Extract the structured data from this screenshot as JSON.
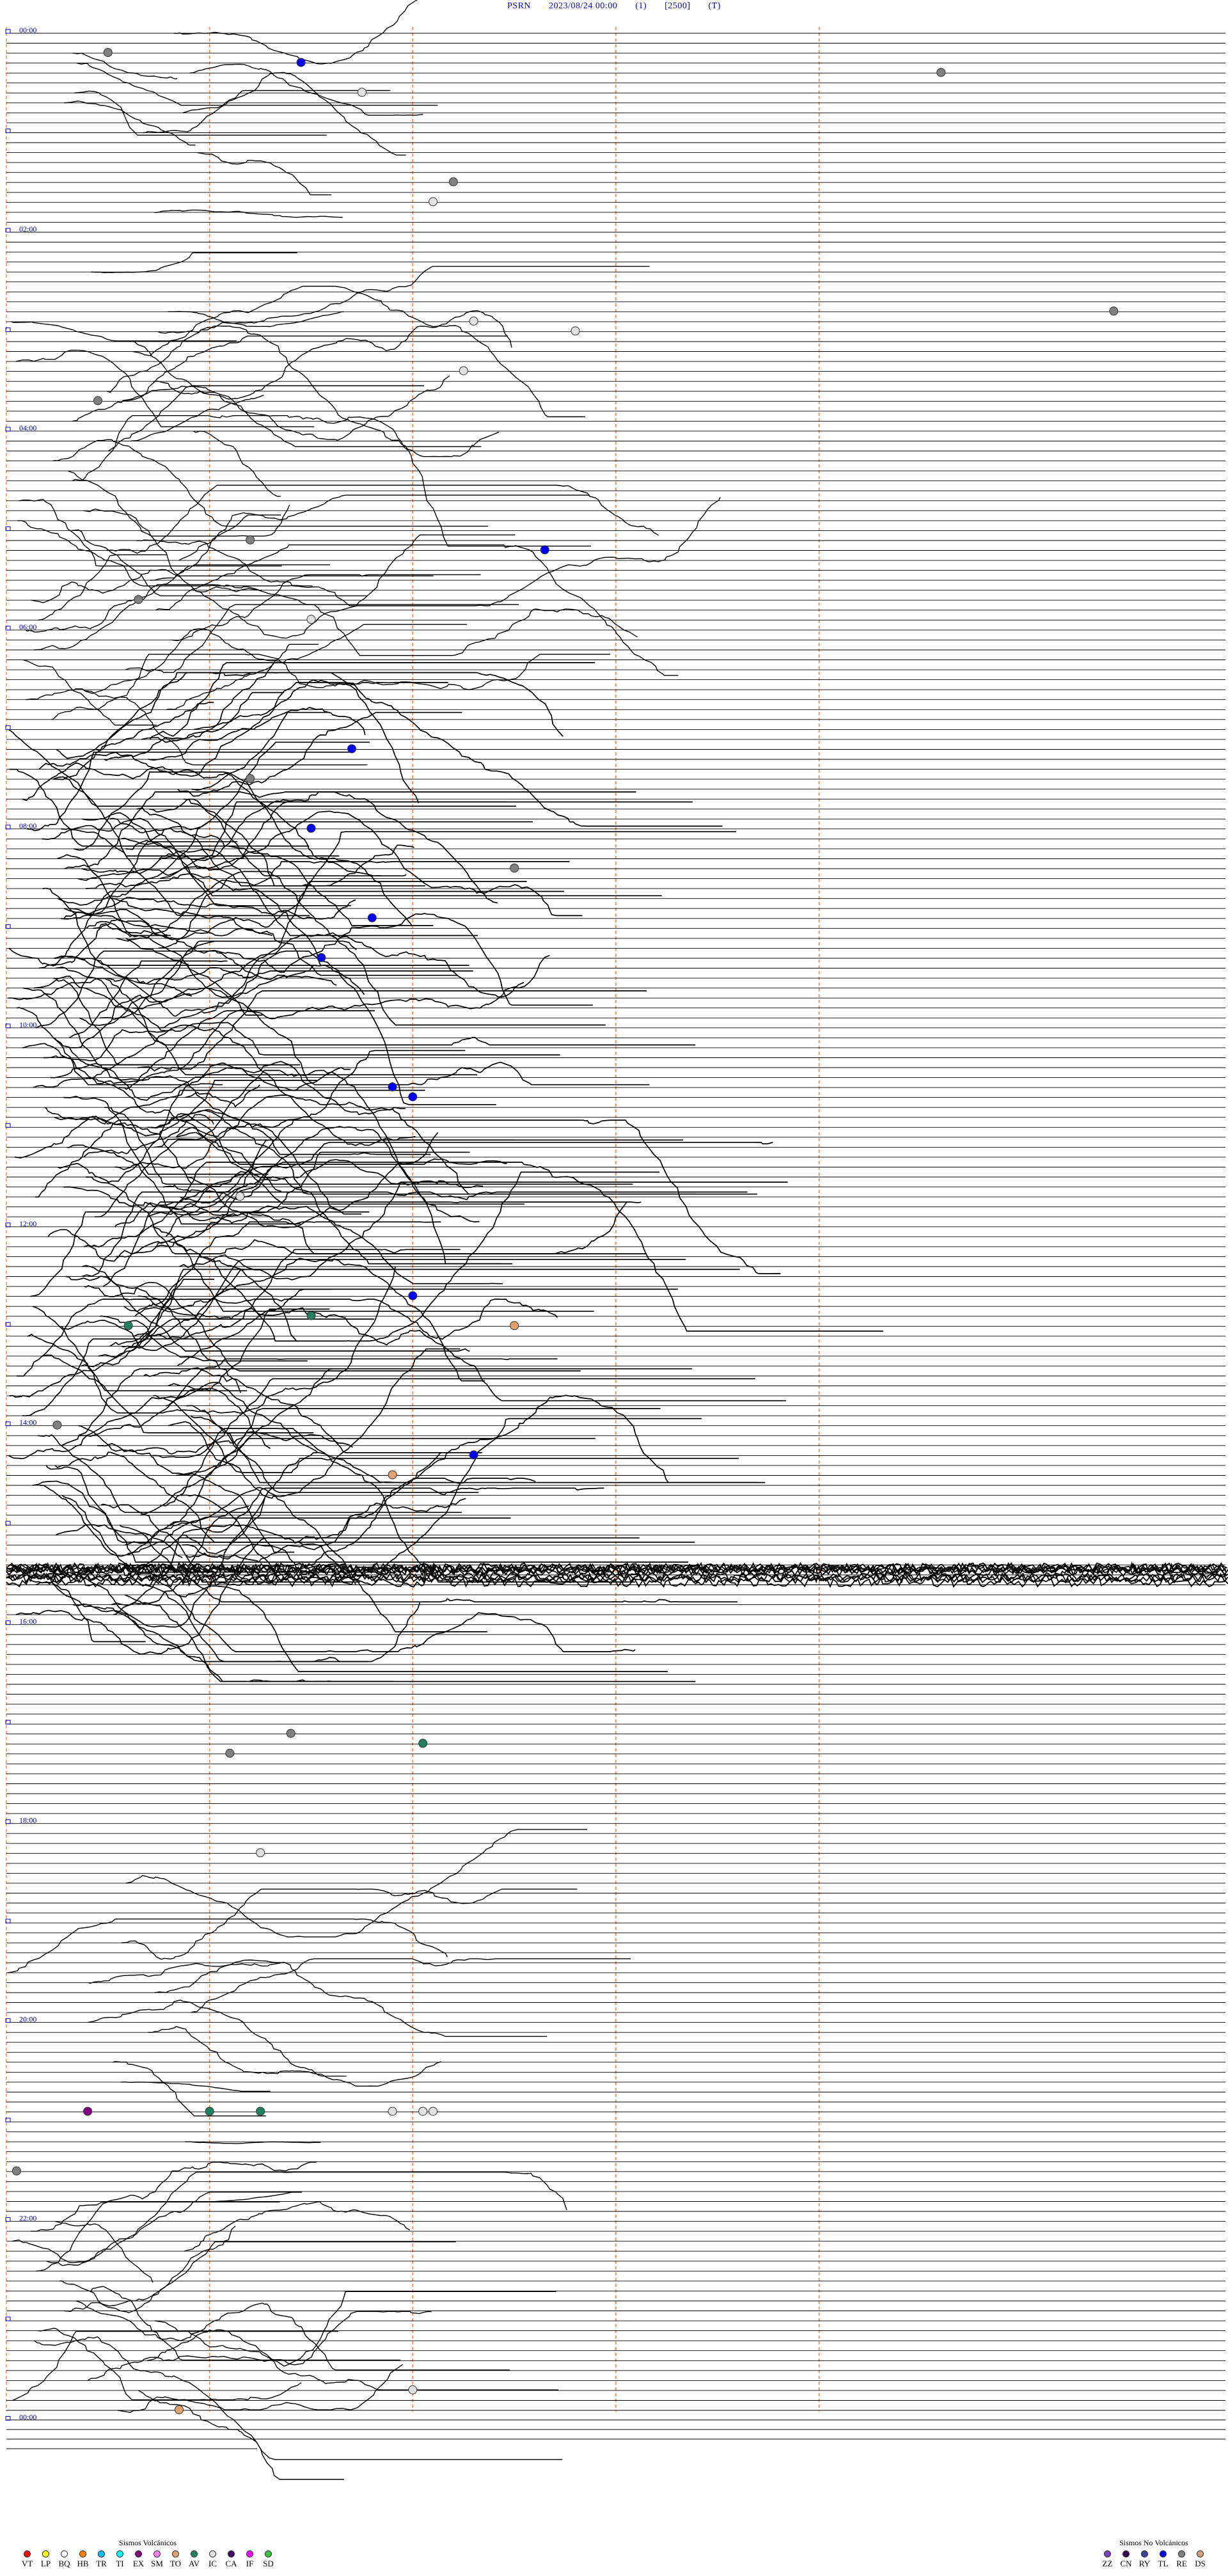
{
  "header": {
    "station": "PSRN",
    "datetime": "2023/08/24 00:00",
    "channel": "(1)",
    "scale": "[2500]",
    "mode": "(T)"
  },
  "chart_data": {
    "type": "helicorder",
    "rows": 240,
    "minutes_per_row": 6,
    "minute_marks": [
      1,
      2,
      3,
      4
    ],
    "time_labels": [
      "00:00",
      "02:00",
      "04:00",
      "06:00",
      "08:00",
      "10:00",
      "12:00",
      "14:00",
      "16:00",
      "18:00",
      "20:00",
      "22:00",
      "00:00"
    ],
    "time_label_rows": [
      0,
      20,
      40,
      60,
      80,
      100,
      120,
      140,
      160,
      180,
      200,
      220,
      240
    ],
    "activity": [
      {
        "from_row": 0,
        "to_row": 14,
        "level": 0.55
      },
      {
        "from_row": 14,
        "to_row": 30,
        "level": 0.25
      },
      {
        "from_row": 30,
        "to_row": 70,
        "level": 0.85
      },
      {
        "from_row": 70,
        "to_row": 120,
        "level": 1.0
      },
      {
        "from_row": 120,
        "to_row": 130,
        "level": 1.1
      },
      {
        "from_row": 130,
        "to_row": 160,
        "level": 1.0
      },
      {
        "from_row": 160,
        "to_row": 185,
        "level": 0.08
      },
      {
        "from_row": 185,
        "to_row": 205,
        "level": 0.7
      },
      {
        "from_row": 205,
        "to_row": 220,
        "level": 0.12
      },
      {
        "from_row": 220,
        "to_row": 240,
        "level": 0.9
      }
    ],
    "events": [
      {
        "row": 3,
        "minute": 1.45,
        "type": "TL"
      },
      {
        "row": 4,
        "minute": 4.6,
        "type": "RE"
      },
      {
        "row": 2,
        "minute": 0.5,
        "type": "RE"
      },
      {
        "row": 6,
        "minute": 1.75,
        "type": "IC"
      },
      {
        "row": 15,
        "minute": 2.2,
        "type": "RE"
      },
      {
        "row": 17,
        "minute": 2.1,
        "type": "IC"
      },
      {
        "row": 28,
        "minute": 5.45,
        "type": "RE"
      },
      {
        "row": 29,
        "minute": 2.3,
        "type": "IC"
      },
      {
        "row": 30,
        "minute": 2.8,
        "type": "IC"
      },
      {
        "row": 34,
        "minute": 2.25,
        "type": "IC"
      },
      {
        "row": 37,
        "minute": 0.45,
        "type": "RE"
      },
      {
        "row": 51,
        "minute": 1.2,
        "type": "RE"
      },
      {
        "row": 52,
        "minute": 2.65,
        "type": "TL"
      },
      {
        "row": 57,
        "minute": 0.65,
        "type": "RE"
      },
      {
        "row": 59,
        "minute": 1.5,
        "type": "IC"
      },
      {
        "row": 72,
        "minute": 1.7,
        "type": "TL"
      },
      {
        "row": 75,
        "minute": 1.2,
        "type": "RE"
      },
      {
        "row": 80,
        "minute": 1.5,
        "type": "TL"
      },
      {
        "row": 84,
        "minute": 2.5,
        "type": "RE"
      },
      {
        "row": 89,
        "minute": 1.8,
        "type": "TL"
      },
      {
        "row": 93,
        "minute": 1.55,
        "type": "TL"
      },
      {
        "row": 106,
        "minute": 1.9,
        "type": "TL"
      },
      {
        "row": 107,
        "minute": 2.0,
        "type": "TL"
      },
      {
        "row": 117,
        "minute": 1.15,
        "type": "IC"
      },
      {
        "row": 127,
        "minute": 2.0,
        "type": "TL"
      },
      {
        "row": 129,
        "minute": 1.5,
        "type": "AV"
      },
      {
        "row": 130,
        "minute": 0.6,
        "type": "AV"
      },
      {
        "row": 130,
        "minute": 2.5,
        "type": "TO"
      },
      {
        "row": 140,
        "minute": 0.25,
        "type": "RE"
      },
      {
        "row": 143,
        "minute": 2.3,
        "type": "TL"
      },
      {
        "row": 145,
        "minute": 1.9,
        "type": "TO"
      },
      {
        "row": 171,
        "minute": 1.4,
        "type": "RE"
      },
      {
        "row": 172,
        "minute": 2.05,
        "type": "AV"
      },
      {
        "row": 173,
        "minute": 1.1,
        "type": "RE"
      },
      {
        "row": 183,
        "minute": 1.25,
        "type": "IC"
      },
      {
        "row": 209,
        "minute": 0.4,
        "type": "EX"
      },
      {
        "row": 209,
        "minute": 1.0,
        "type": "AV"
      },
      {
        "row": 209,
        "minute": 1.25,
        "type": "AV"
      },
      {
        "row": 209,
        "minute": 1.9,
        "type": "IC"
      },
      {
        "row": 209,
        "minute": 2.05,
        "type": "IC"
      },
      {
        "row": 209,
        "minute": 2.1,
        "type": "IC"
      },
      {
        "row": 215,
        "minute": 0.05,
        "type": "RE"
      },
      {
        "row": 239,
        "minute": 0.85,
        "type": "TO"
      },
      {
        "row": 237,
        "minute": 2.0,
        "type": "IC"
      }
    ]
  },
  "legend": {
    "volcanic_title": "Sismos Volcánicos",
    "volcanic": [
      {
        "code": "VT",
        "color": "#ff0000"
      },
      {
        "code": "LP",
        "color": "#ffff00"
      },
      {
        "code": "BQ",
        "color": "#ffffff"
      },
      {
        "code": "HB",
        "color": "#ff8000"
      },
      {
        "code": "TR",
        "color": "#00c0ff"
      },
      {
        "code": "TI",
        "color": "#00ffff"
      },
      {
        "code": "EX",
        "color": "#800080"
      },
      {
        "code": "SM",
        "color": "#ff80ff"
      },
      {
        "code": "TO",
        "color": "#e0a070"
      },
      {
        "code": "AV",
        "color": "#208060"
      },
      {
        "code": "IC",
        "color": "#e0e0e0"
      },
      {
        "code": "CA",
        "color": "#400060"
      },
      {
        "code": "IF",
        "color": "#ff00ff"
      },
      {
        "code": "SD",
        "color": "#40c040"
      }
    ],
    "nonvolcanic_title": "Sismos No Volcánicos",
    "nonvolcanic": [
      {
        "code": "ZZ",
        "color": "#8040c0"
      },
      {
        "code": "CN",
        "color": "#300050"
      },
      {
        "code": "RY",
        "color": "#4040a0"
      },
      {
        "code": "TL",
        "color": "#0000ff"
      },
      {
        "code": "RE",
        "color": "#808080"
      },
      {
        "code": "DS",
        "color": "#d0a080"
      }
    ]
  }
}
